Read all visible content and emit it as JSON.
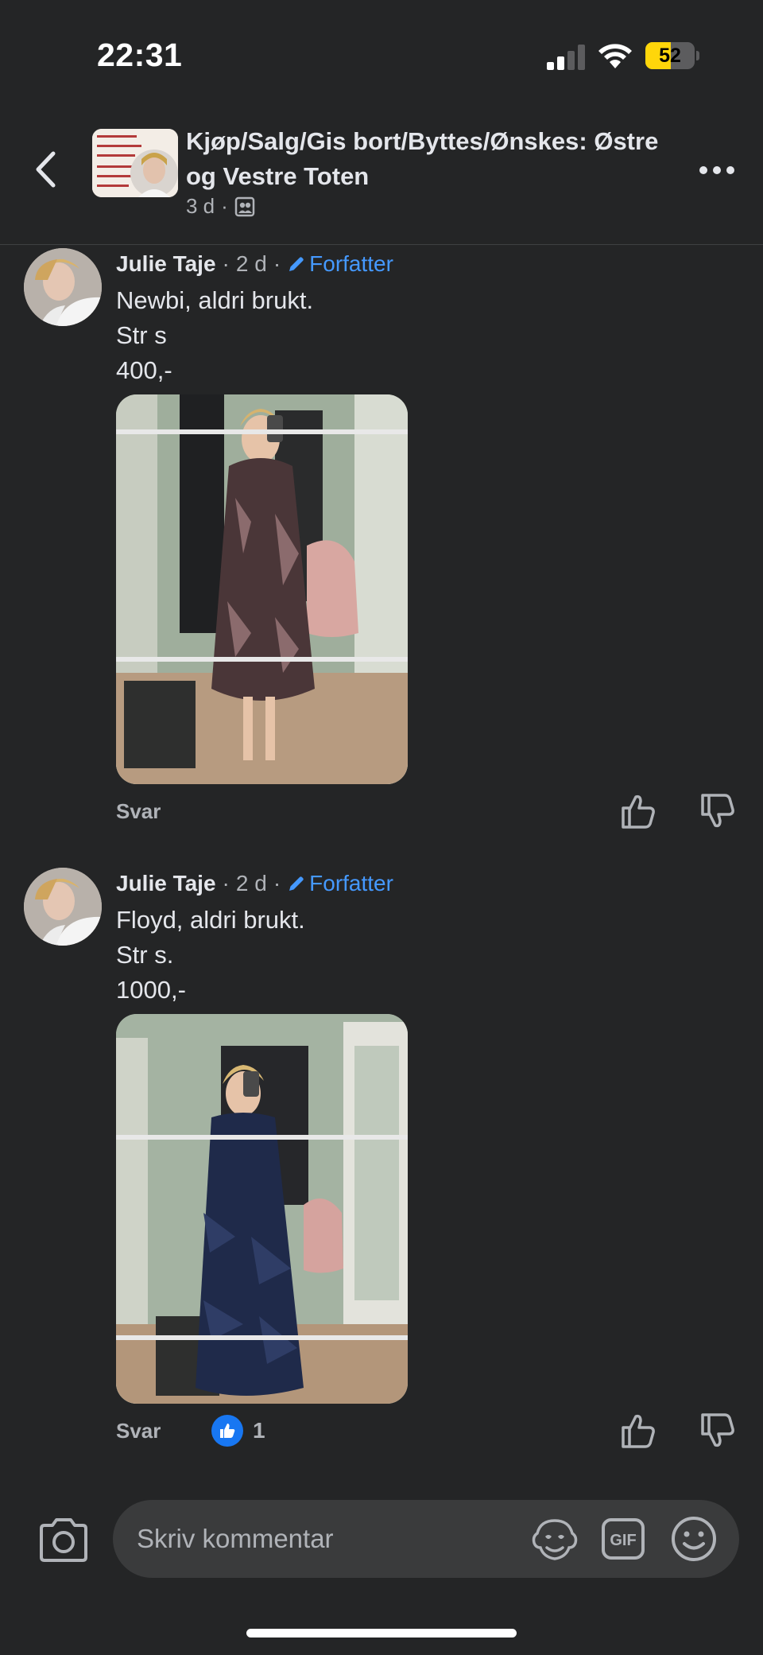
{
  "status_bar": {
    "time": "22:31",
    "battery_level": "52",
    "battery_fraction": 0.52
  },
  "header": {
    "group_title": "Kjøp/Salg/Gis bort/Byttes/Ønskes: Østre og Vestre Toten",
    "post_age": "3 d",
    "meta_separator": "·",
    "audience_icon": "group-members-icon"
  },
  "comments": [
    {
      "author": "Julie Taje",
      "sep1": "·",
      "age": "2 d",
      "sep2": "·",
      "author_badge": "Forfatter",
      "lines": [
        "Newbi, aldri brukt.",
        "Str s",
        "400,-"
      ],
      "reply_label": "Svar",
      "reaction_count": ""
    },
    {
      "author": "Julie Taje",
      "sep1": "·",
      "age": "2 d",
      "sep2": "·",
      "author_badge": "Forfatter",
      "lines": [
        "Floyd, aldri brukt.",
        "Str s.",
        "1000,-"
      ],
      "reply_label": "Svar",
      "reaction_count": "1"
    }
  ],
  "composer": {
    "placeholder": "Skriv kommentar",
    "gif_label": "GIF"
  },
  "colors": {
    "background": "#242526",
    "text_primary": "#e4e6eb",
    "text_secondary": "#b0b3b8",
    "author_badge": "#4599ff",
    "like_blue": "#1877f2",
    "battery_yellow": "#ffd60a"
  }
}
